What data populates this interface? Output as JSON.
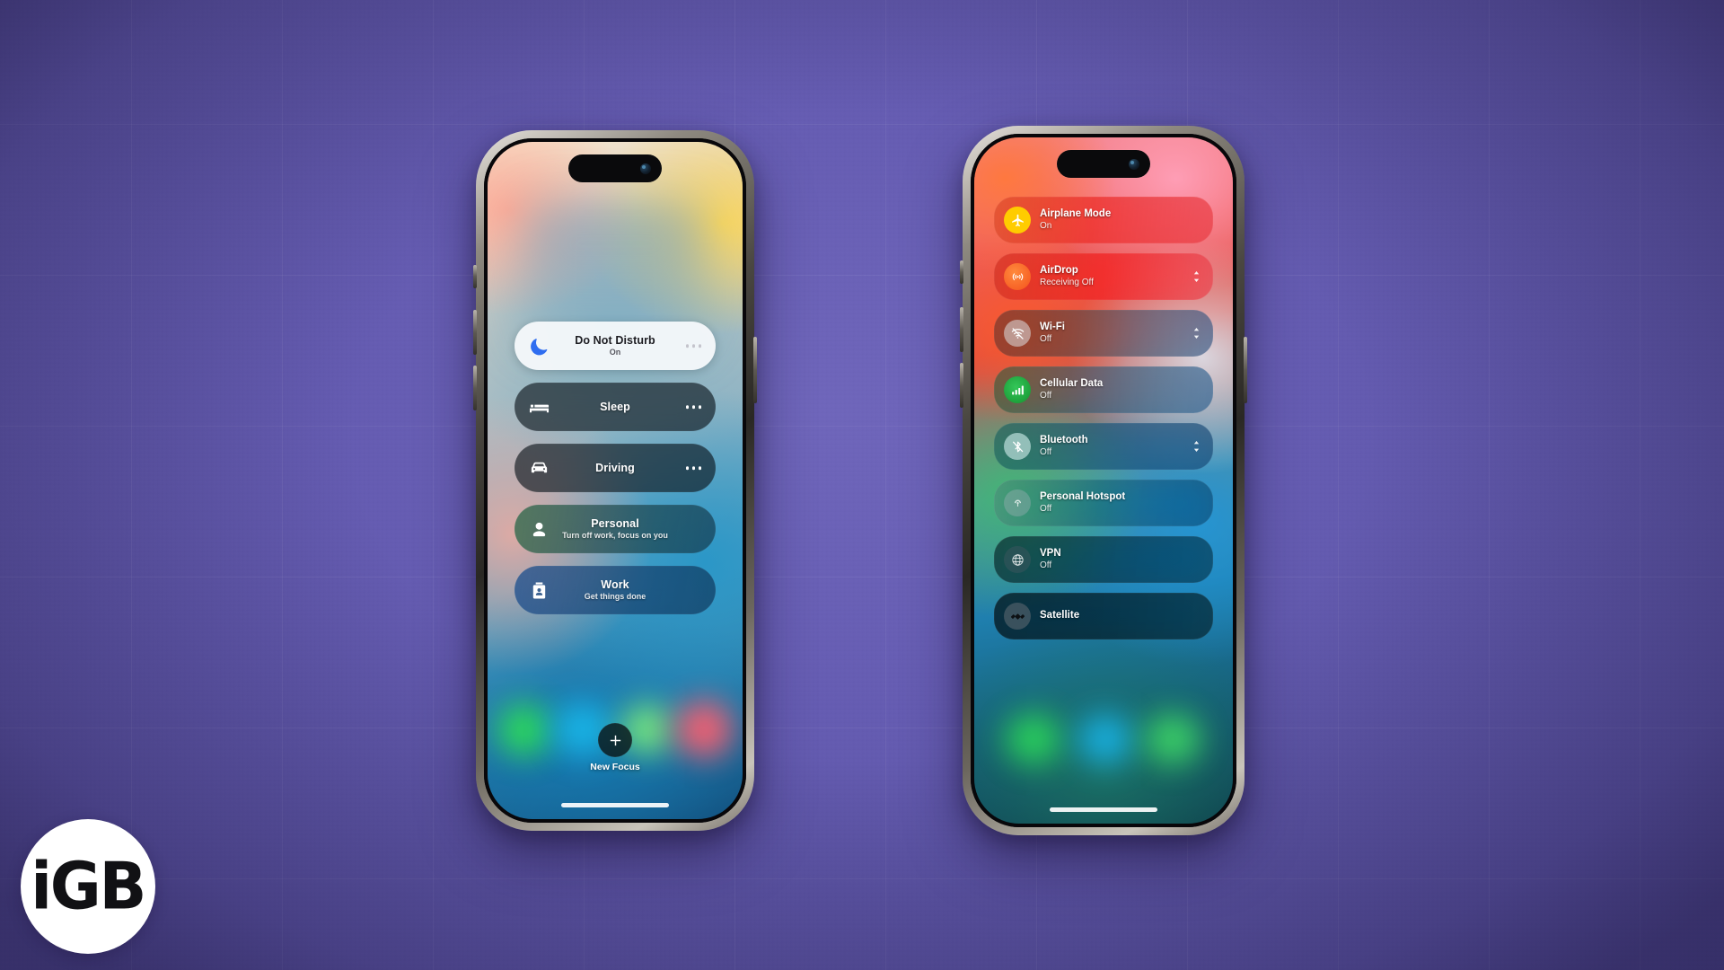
{
  "background": {
    "color": "#6159ac",
    "description": "purple gridded desk surface"
  },
  "watermark": {
    "name": "iGB",
    "text": "iGB",
    "circle_color": "#ffffff",
    "text_color": "#111114"
  },
  "phone_left": {
    "device": "iPhone",
    "screen": "Focus control panel",
    "focus_modes": [
      {
        "icon": "moon-icon",
        "title": "Do Not Disturb",
        "subtitle": "On",
        "state": "active",
        "accent": "#2f6df0",
        "menu": "more-options"
      },
      {
        "icon": "bed-icon",
        "title": "Sleep",
        "subtitle": "",
        "state": "inactive",
        "accent": "#ffffff",
        "menu": "more-options"
      },
      {
        "icon": "car-icon",
        "title": "Driving",
        "subtitle": "",
        "state": "inactive",
        "accent": "#ffffff",
        "menu": "more-options"
      },
      {
        "icon": "person-icon",
        "title": "Personal",
        "subtitle": "Turn off work, focus on you",
        "state": "inactive",
        "accent": "#ffffff",
        "menu": ""
      },
      {
        "icon": "badge-icon",
        "title": "Work",
        "subtitle": "Get things done",
        "state": "inactive",
        "accent": "#ffffff",
        "menu": ""
      }
    ],
    "new_focus": {
      "icon": "plus-icon",
      "label": "New Focus"
    }
  },
  "phone_right": {
    "device": "iPhone",
    "screen": "Control Center connectivity",
    "controls": [
      {
        "icon": "airplane-icon",
        "title": "Airplane Mode",
        "subtitle": "On",
        "icon_color": "#ffcc00",
        "icon_glyph_color": "#ffffff",
        "chevron": false
      },
      {
        "icon": "airdrop-icon",
        "title": "AirDrop",
        "subtitle": "Receiving Off",
        "icon_color": "#ff6a2b",
        "icon_glyph_color": "#ffffff",
        "chevron": true
      },
      {
        "icon": "wifi-slash-icon",
        "title": "Wi-Fi",
        "subtitle": "Off",
        "icon_color": "#b09a96",
        "icon_glyph_color": "#ffffff",
        "chevron": true
      },
      {
        "icon": "cellular-icon",
        "title": "Cellular Data",
        "subtitle": "Off",
        "icon_color": "#2aa84a",
        "icon_glyph_color": "#ffffff",
        "chevron": false
      },
      {
        "icon": "bluetooth-slash-icon",
        "title": "Bluetooth",
        "subtitle": "Off",
        "icon_color": "#9fc8c4",
        "icon_glyph_color": "#ffffff",
        "chevron": true
      },
      {
        "icon": "hotspot-icon",
        "title": "Personal Hotspot",
        "subtitle": "Off",
        "icon_color": "#9aa6ab",
        "icon_glyph_color": "#ffffff",
        "chevron": false
      },
      {
        "icon": "vpn-icon",
        "title": "VPN",
        "subtitle": "Off",
        "icon_color": "#2d4d52",
        "icon_glyph_color": "#ffffff",
        "chevron": false
      },
      {
        "icon": "satellite-icon",
        "title": "Satellite",
        "subtitle": "",
        "icon_color": "#46505a",
        "icon_glyph_color": "#ffffff",
        "chevron": false
      }
    ]
  }
}
